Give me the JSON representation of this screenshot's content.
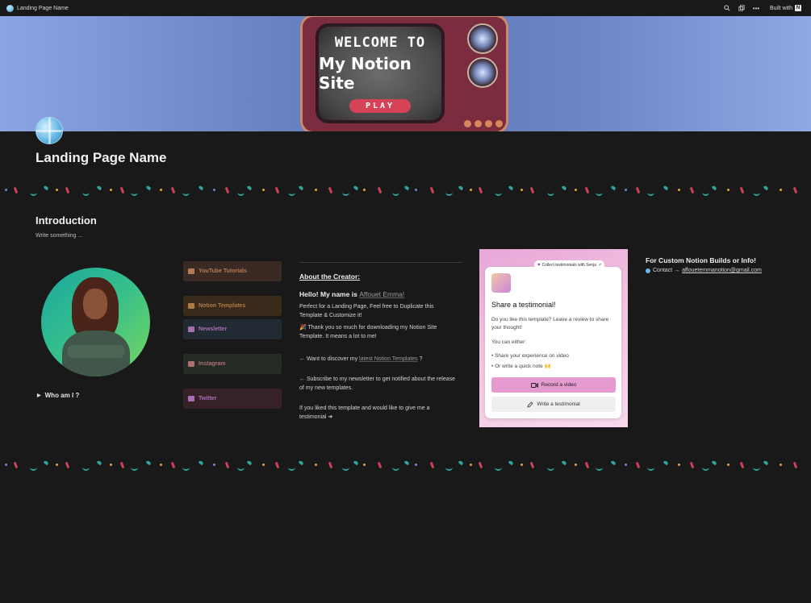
{
  "topbar": {
    "title": "Landing Page Name",
    "built_with": "Built with",
    "built_logo": "N",
    "icons": [
      "search-icon",
      "duplicate-icon",
      "more-icon"
    ]
  },
  "cover": {
    "line1": "WELCOME TO",
    "line2": "My Notion Site",
    "play": "PLAY"
  },
  "page": {
    "title": "Landing Page Name",
    "intro_heading": "Introduction",
    "intro_sub": "Write something ...",
    "who_toggle": "Who am I ?"
  },
  "nav_buttons": [
    {
      "label": "YouTube Tutorials",
      "bg": "#3a2a23",
      "fg": "#b47a55",
      "icon": "#b47a55"
    },
    {
      "label": "Notion Templates",
      "bg": "#3a2a1c",
      "fg": "#b07a45",
      "icon": "#b07a45"
    },
    {
      "label": "Newsletter",
      "bg": "#222b33",
      "fg": "#a56fb0",
      "icon": "#a56fb0"
    },
    {
      "label": "Instagram",
      "bg": "#252c25",
      "fg": "#b06f6f",
      "icon": "#b07070"
    },
    {
      "label": "Twitter",
      "bg": "#352126",
      "fg": "#a86fb5",
      "icon": "#a86fb5"
    }
  ],
  "about": {
    "heading": "About the Creator:",
    "hello": "Hello! My name is",
    "name": "Affouet Emma!",
    "p1": "Perfect for a Landing Page, Feel free to Duplicate this Template & Customize it!",
    "p2": "🎉 Thank you so much for downloading my Notion Site Template. It means a lot to me!",
    "p3_pre": "← Want to discover my ",
    "p3_link": "latest Notion Templates",
    "p3_post": " ?",
    "p4": "← Subscribe to my newsletter to get notified about the release of my new templates.",
    "p5": "If you liked this template and would like to give me a testimonial ➔"
  },
  "widget": {
    "tag": "Collect testimonials with Senja",
    "title": "Share a testimonial!",
    "text": "Do you like this template? Leave a review to share your thought!",
    "either": "You can either:",
    "opt1": "Share your experience on video",
    "opt2": "Or write a quick note 🙌",
    "btn_video": "Record a video",
    "btn_write": "Write a testimonial"
  },
  "contact": {
    "heading": "For Custom Notion Builds or Info!",
    "label": "Contact →",
    "email": "affouetemmanotion@gmail.com"
  }
}
